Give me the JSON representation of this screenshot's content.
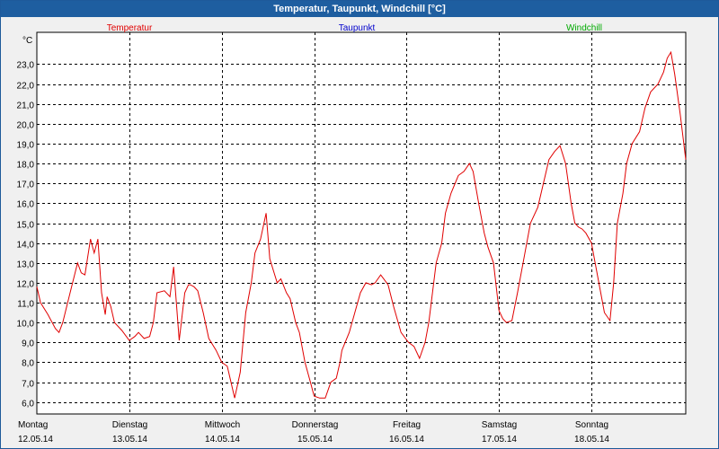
{
  "window": {
    "title": "Temperatur, Taupunkt, Windchill [°C]"
  },
  "colors": {
    "temperatur": "#e00000",
    "taupunkt": "#0000cc",
    "windchill": "#00aa00",
    "grid": "#000000",
    "titlebar": "#1e5ea0"
  },
  "chart_data": {
    "type": "line",
    "title": "Temperatur, Taupunkt, Windchill [°C]",
    "ylabel": "°C",
    "ylim": [
      5.4,
      24.6
    ],
    "xlim": [
      0,
      7.02
    ],
    "grid": true,
    "legend_placement": "top",
    "yticks": [
      6.0,
      7.0,
      8.0,
      9.0,
      10.0,
      11.0,
      12.0,
      13.0,
      14.0,
      15.0,
      16.0,
      17.0,
      18.0,
      19.0,
      20.0,
      21.0,
      22.0,
      23.0
    ],
    "ytick_labels": [
      "6,0",
      "7,0",
      "8,0",
      "9,0",
      "10,0",
      "11,0",
      "12,0",
      "13,0",
      "14,0",
      "15,0",
      "16,0",
      "17,0",
      "18,0",
      "19,0",
      "20,0",
      "21,0",
      "22,0",
      "23,0"
    ],
    "xticks": [
      {
        "day": "Montag",
        "date": "12.05.14"
      },
      {
        "day": "Dienstag",
        "date": "13.05.14"
      },
      {
        "day": "Mittwoch",
        "date": "14.05.14"
      },
      {
        "day": "Donnerstag",
        "date": "15.05.14"
      },
      {
        "day": "Freitag",
        "date": "16.05.14"
      },
      {
        "day": "Samstag",
        "date": "17.05.14"
      },
      {
        "day": "Sonntag",
        "date": "18.05.14"
      }
    ],
    "series": [
      {
        "name": "Temperatur",
        "x": [
          0,
          0.04,
          0.12,
          0.2,
          0.24,
          0.28,
          0.36,
          0.44,
          0.48,
          0.52,
          0.58,
          0.62,
          0.66,
          0.7,
          0.74,
          0.76,
          0.8,
          0.84,
          0.92,
          1.0,
          1.06,
          1.1,
          1.16,
          1.22,
          1.26,
          1.3,
          1.38,
          1.44,
          1.48,
          1.54,
          1.6,
          1.64,
          1.66,
          1.7,
          1.74,
          1.8,
          1.86,
          1.94,
          2.0,
          2.06,
          2.14,
          2.2,
          2.26,
          2.32,
          2.36,
          2.42,
          2.48,
          2.52,
          2.6,
          2.64,
          2.7,
          2.74,
          2.8,
          2.84,
          2.9,
          2.96,
          3.0,
          3.06,
          3.12,
          3.18,
          3.24,
          3.28,
          3.3,
          3.38,
          3.44,
          3.5,
          3.56,
          3.62,
          3.66,
          3.72,
          3.8,
          3.86,
          3.94,
          4.02,
          4.08,
          4.14,
          4.2,
          4.24,
          4.32,
          4.38,
          4.42,
          4.48,
          4.56,
          4.62,
          4.68,
          4.72,
          4.78,
          4.84,
          4.88,
          4.94,
          5.0,
          5.04,
          5.08,
          5.14,
          5.2,
          5.26,
          5.34,
          5.42,
          5.48,
          5.54,
          5.6,
          5.66,
          5.72,
          5.78,
          5.82,
          5.86,
          5.9,
          5.94,
          6.0,
          6.04,
          6.1,
          6.14,
          6.2,
          6.24,
          6.28,
          6.34,
          6.38,
          6.44,
          6.52,
          6.58,
          6.64,
          6.72,
          6.78,
          6.82,
          6.86,
          6.9,
          6.96,
          7.02
        ],
        "values": [
          11.8,
          11.0,
          10.4,
          9.7,
          9.5,
          10.0,
          11.5,
          13.0,
          12.5,
          12.4,
          14.2,
          13.5,
          14.2,
          11.5,
          10.4,
          11.3,
          10.8,
          10.0,
          9.6,
          9.1,
          9.3,
          9.5,
          9.2,
          9.3,
          10.0,
          11.5,
          11.6,
          11.3,
          12.8,
          9.1,
          11.5,
          11.9,
          11.9,
          11.8,
          11.6,
          10.5,
          9.2,
          8.6,
          8.0,
          7.8,
          6.2,
          7.5,
          10.5,
          12.0,
          13.5,
          14.2,
          15.5,
          13.2,
          12.0,
          12.2,
          11.5,
          11.2,
          10.0,
          9.5,
          8.0,
          7.0,
          6.3,
          6.2,
          6.2,
          7.0,
          7.2,
          8.0,
          8.6,
          9.5,
          10.5,
          11.5,
          12.0,
          11.9,
          12.0,
          12.4,
          11.9,
          10.8,
          9.5,
          9.0,
          8.8,
          8.2,
          9.0,
          10.0,
          13.0,
          14.0,
          15.5,
          16.5,
          17.4,
          17.6,
          18.0,
          17.6,
          16.0,
          14.5,
          13.8,
          13.0,
          10.6,
          10.2,
          10.0,
          10.1,
          11.5,
          13.0,
          15.0,
          15.8,
          17.0,
          18.2,
          18.6,
          18.9,
          18.0,
          16.0,
          15.0,
          14.8,
          14.7,
          14.5,
          14.0,
          13.0,
          11.5,
          10.5,
          10.1,
          12.0,
          15.0,
          16.5,
          18.0,
          19.0,
          19.6,
          20.8,
          21.6,
          22.0,
          22.6,
          23.3,
          23.6,
          22.5,
          20.5,
          18.2
        ]
      },
      {
        "name": "Taupunkt",
        "values": []
      },
      {
        "name": "Windchill",
        "values": []
      }
    ]
  }
}
